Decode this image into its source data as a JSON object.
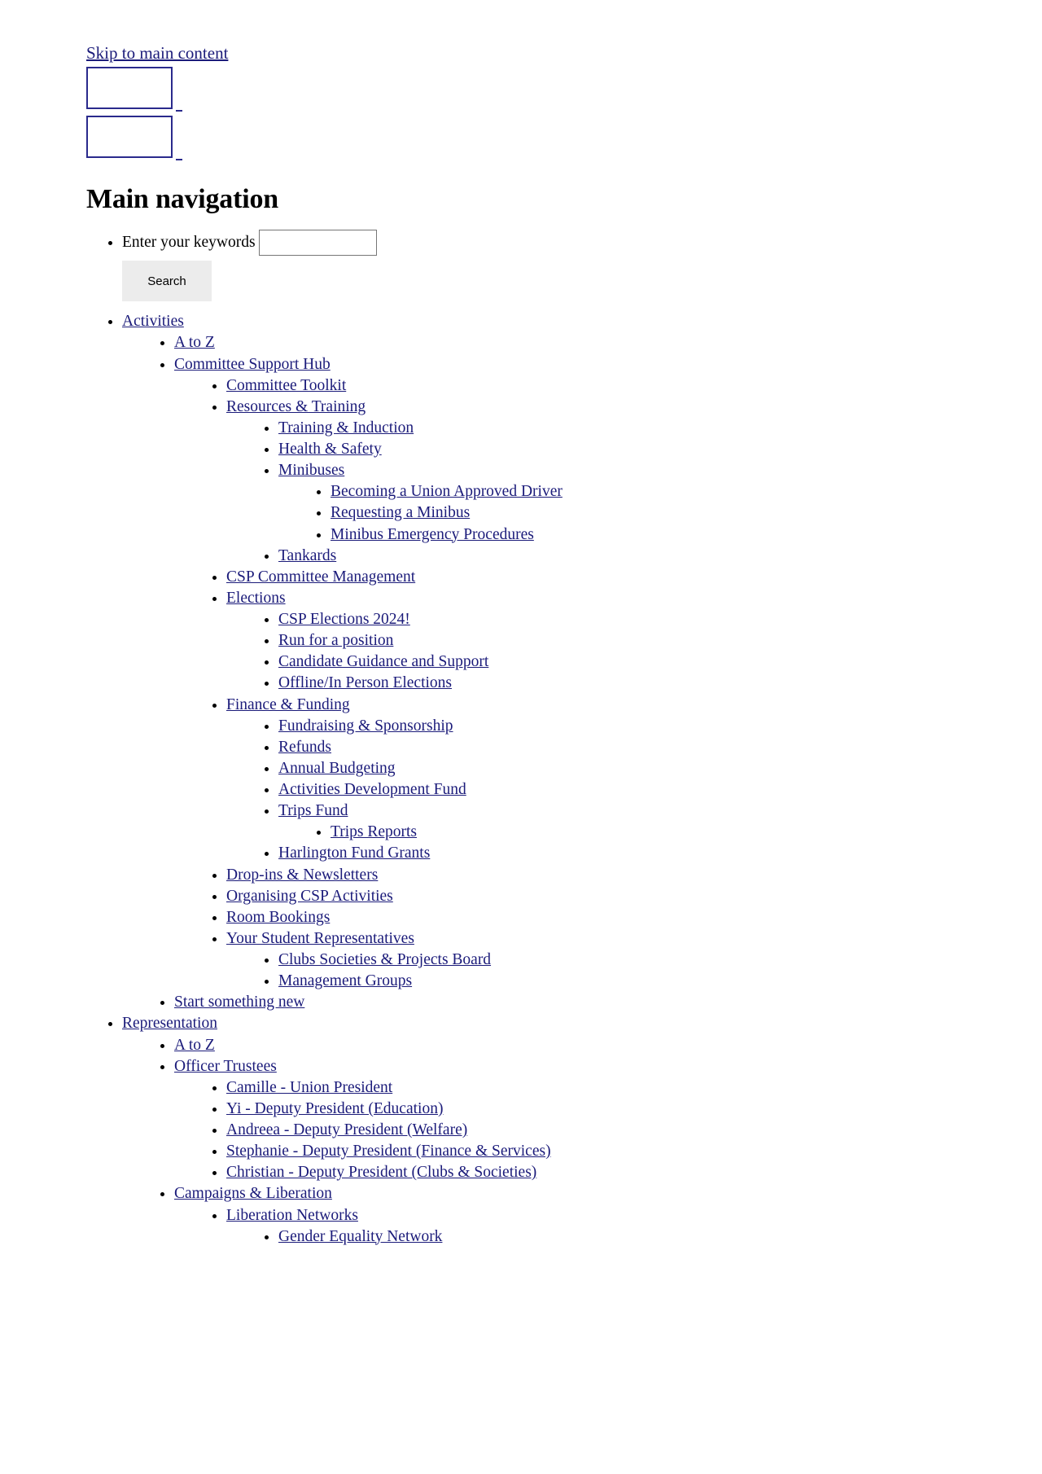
{
  "skip_link": "Skip to main content",
  "broken_images": [
    {
      "name": "site-logo-primary"
    },
    {
      "name": "site-logo-secondary"
    }
  ],
  "heading": "Main navigation",
  "search": {
    "label": "Enter your keywords",
    "value": "",
    "placeholder": "",
    "button_label": "Search"
  },
  "nav": [
    {
      "label": "Activities",
      "children": [
        {
          "label": "A to Z"
        },
        {
          "label": "Committee Support Hub",
          "children": [
            {
              "label": "Committee Toolkit"
            },
            {
              "label": "Resources & Training",
              "children": [
                {
                  "label": "Training & Induction"
                },
                {
                  "label": "Health & Safety"
                },
                {
                  "label": "Minibuses",
                  "children": [
                    {
                      "label": "Becoming a Union Approved Driver"
                    },
                    {
                      "label": "Requesting a Minibus"
                    },
                    {
                      "label": "Minibus Emergency Procedures"
                    }
                  ]
                },
                {
                  "label": "Tankards"
                }
              ]
            },
            {
              "label": "CSP Committee Management"
            },
            {
              "label": "Elections",
              "children": [
                {
                  "label": "CSP Elections 2024!"
                },
                {
                  "label": "Run for a position"
                },
                {
                  "label": "Candidate Guidance and Support"
                },
                {
                  "label": "Offline/In Person Elections"
                }
              ]
            },
            {
              "label": "Finance & Funding",
              "children": [
                {
                  "label": "Fundraising & Sponsorship"
                },
                {
                  "label": "Refunds"
                },
                {
                  "label": "Annual Budgeting"
                },
                {
                  "label": "Activities Development Fund"
                },
                {
                  "label": "Trips Fund",
                  "children": [
                    {
                      "label": "Trips Reports"
                    }
                  ]
                },
                {
                  "label": "Harlington Fund Grants"
                }
              ]
            },
            {
              "label": "Drop-ins & Newsletters"
            },
            {
              "label": "Organising CSP Activities"
            },
            {
              "label": "Room Bookings"
            },
            {
              "label": "Your Student Representatives",
              "children": [
                {
                  "label": "Clubs Societies & Projects Board"
                },
                {
                  "label": "Management Groups"
                }
              ]
            }
          ]
        },
        {
          "label": "Start something new"
        }
      ]
    },
    {
      "label": "Representation",
      "children": [
        {
          "label": "A to Z"
        },
        {
          "label": "Officer Trustees",
          "children": [
            {
              "label": "Camille - Union President"
            },
            {
              "label": "Yi - Deputy President (Education)"
            },
            {
              "label": "Andreea - Deputy President (Welfare)"
            },
            {
              "label": "Stephanie - Deputy President (Finance & Services)"
            },
            {
              "label": "Christian - Deputy President (Clubs & Societies)"
            }
          ]
        },
        {
          "label": "Campaigns & Liberation",
          "children": [
            {
              "label": "Liberation Networks",
              "children": [
                {
                  "label": "Gender Equality Network"
                }
              ]
            }
          ]
        }
      ]
    }
  ],
  "colors": {
    "link": "#1b1b7a",
    "text": "#000000",
    "button_bg": "#ececec",
    "image_border": "#2a2a8c",
    "background": "#ffffff"
  }
}
